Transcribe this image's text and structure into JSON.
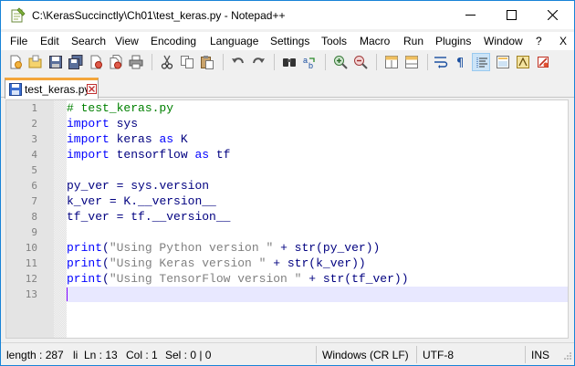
{
  "window": {
    "title": "C:\\KerasSuccinctly\\Ch01\\test_keras.py - Notepad++"
  },
  "menu": {
    "items": [
      "File",
      "Edit",
      "Search",
      "View",
      "Encoding",
      "Language",
      "Settings",
      "Tools",
      "Macro",
      "Run",
      "Plugins",
      "Window",
      "?",
      "X"
    ]
  },
  "toolbar": {
    "icons": [
      "new-file-icon",
      "open-file-icon",
      "save-icon",
      "save-all-icon",
      "close-icon",
      "close-all-icon",
      "print-icon",
      "cut-icon",
      "copy-icon",
      "paste-icon",
      "undo-icon",
      "redo-icon",
      "find-icon",
      "replace-icon",
      "zoom-in-icon",
      "zoom-out-icon",
      "sync-vertical-icon",
      "sync-horizontal-icon",
      "word-wrap-icon",
      "show-all-chars-icon",
      "indent-guide-icon",
      "document-map-icon",
      "function-list-icon",
      "macro-record-icon"
    ]
  },
  "tabs": [
    {
      "label": "test_keras.py",
      "active": true
    }
  ],
  "editor": {
    "lines": [
      {
        "n": "1",
        "text": "# test_keras.py"
      },
      {
        "n": "2",
        "text": "import sys"
      },
      {
        "n": "3",
        "text": "import keras as K"
      },
      {
        "n": "4",
        "text": "import tensorflow as tf"
      },
      {
        "n": "5",
        "text": ""
      },
      {
        "n": "6",
        "text": "py_ver = sys.version"
      },
      {
        "n": "7",
        "text": "k_ver = K.__version__"
      },
      {
        "n": "8",
        "text": "tf_ver = tf.__version__"
      },
      {
        "n": "9",
        "text": ""
      },
      {
        "n": "10",
        "text": "print(\"Using Python version \" + str(py_ver))"
      },
      {
        "n": "11",
        "text": "print(\"Using Keras version \" + str(k_ver))"
      },
      {
        "n": "12",
        "text": "print(\"Using TensorFlow version \" + str(tf_ver))"
      },
      {
        "n": "13",
        "text": ""
      }
    ],
    "current_line": 13,
    "colors": {
      "comment": "#008000",
      "keyword": "#0000ff",
      "identifier": "#000080",
      "string": "#808080",
      "current_line_bg": "#e8e8ff",
      "caret": "#8000ff",
      "tab_accent": "#f4a63b"
    }
  },
  "statusbar": {
    "length": "length : 287",
    "lines": "li",
    "ln": "Ln : 13",
    "col": "Col : 1",
    "sel": "Sel : 0 | 0",
    "eol": "Windows (CR LF)",
    "encoding": "UTF-8",
    "mode": "INS"
  }
}
